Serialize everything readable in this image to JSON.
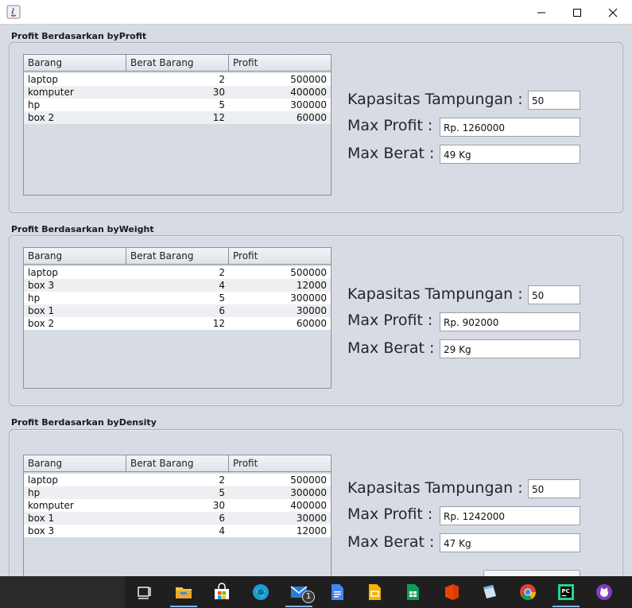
{
  "window": {
    "title": "",
    "controls": [
      "minimize-icon",
      "maximize-icon",
      "close-icon"
    ]
  },
  "table_headers": [
    "Barang",
    "Berat Barang",
    "Profit"
  ],
  "labels": {
    "kapasitas": "Kapasitas Tampungan :",
    "max_profit": "Max Profit :",
    "max_berat": "Max Berat :"
  },
  "sections": [
    {
      "title": "Profit Berdasarkan byProfit",
      "rows": [
        {
          "barang": "laptop",
          "berat": "2",
          "profit": "500000"
        },
        {
          "barang": "komputer",
          "berat": "30",
          "profit": "400000"
        },
        {
          "barang": "hp",
          "berat": "5",
          "profit": "300000"
        },
        {
          "barang": "box 2",
          "berat": "12",
          "profit": "60000"
        }
      ],
      "kapasitas": "50",
      "max_profit": "Rp. 1260000",
      "max_berat": "49 Kg"
    },
    {
      "title": "Profit Berdasarkan byWeight",
      "rows": [
        {
          "barang": "laptop",
          "berat": "2",
          "profit": "500000"
        },
        {
          "barang": "box 3",
          "berat": "4",
          "profit": "12000"
        },
        {
          "barang": "hp",
          "berat": "5",
          "profit": "300000"
        },
        {
          "barang": "box 1",
          "berat": "6",
          "profit": "30000"
        },
        {
          "barang": "box 2",
          "berat": "12",
          "profit": "60000"
        }
      ],
      "kapasitas": "50",
      "max_profit": "Rp. 902000",
      "max_berat": "29 Kg"
    },
    {
      "title": "Profit Berdasarkan byDensity",
      "rows": [
        {
          "barang": "laptop",
          "berat": "2",
          "profit": "500000"
        },
        {
          "barang": "hp",
          "berat": "5",
          "profit": "300000"
        },
        {
          "barang": "komputer",
          "berat": "30",
          "profit": "400000"
        },
        {
          "barang": "box 1",
          "berat": "6",
          "profit": "30000"
        },
        {
          "barang": "box 3",
          "berat": "4",
          "profit": "12000"
        }
      ],
      "kapasitas": "50",
      "max_profit": "Rp. 1242000",
      "max_berat": "47 Kg"
    }
  ],
  "taskbar": {
    "icons": [
      "task-view-icon",
      "file-explorer-icon",
      "microsoft-store-icon",
      "edge-icon",
      "mail-icon",
      "google-docs-icon",
      "google-slides-icon",
      "google-sheets-icon",
      "office-icon",
      "notepad-icon",
      "chrome-icon",
      "pycharm-icon",
      "app-cat-icon"
    ],
    "mail_badge": "1"
  }
}
